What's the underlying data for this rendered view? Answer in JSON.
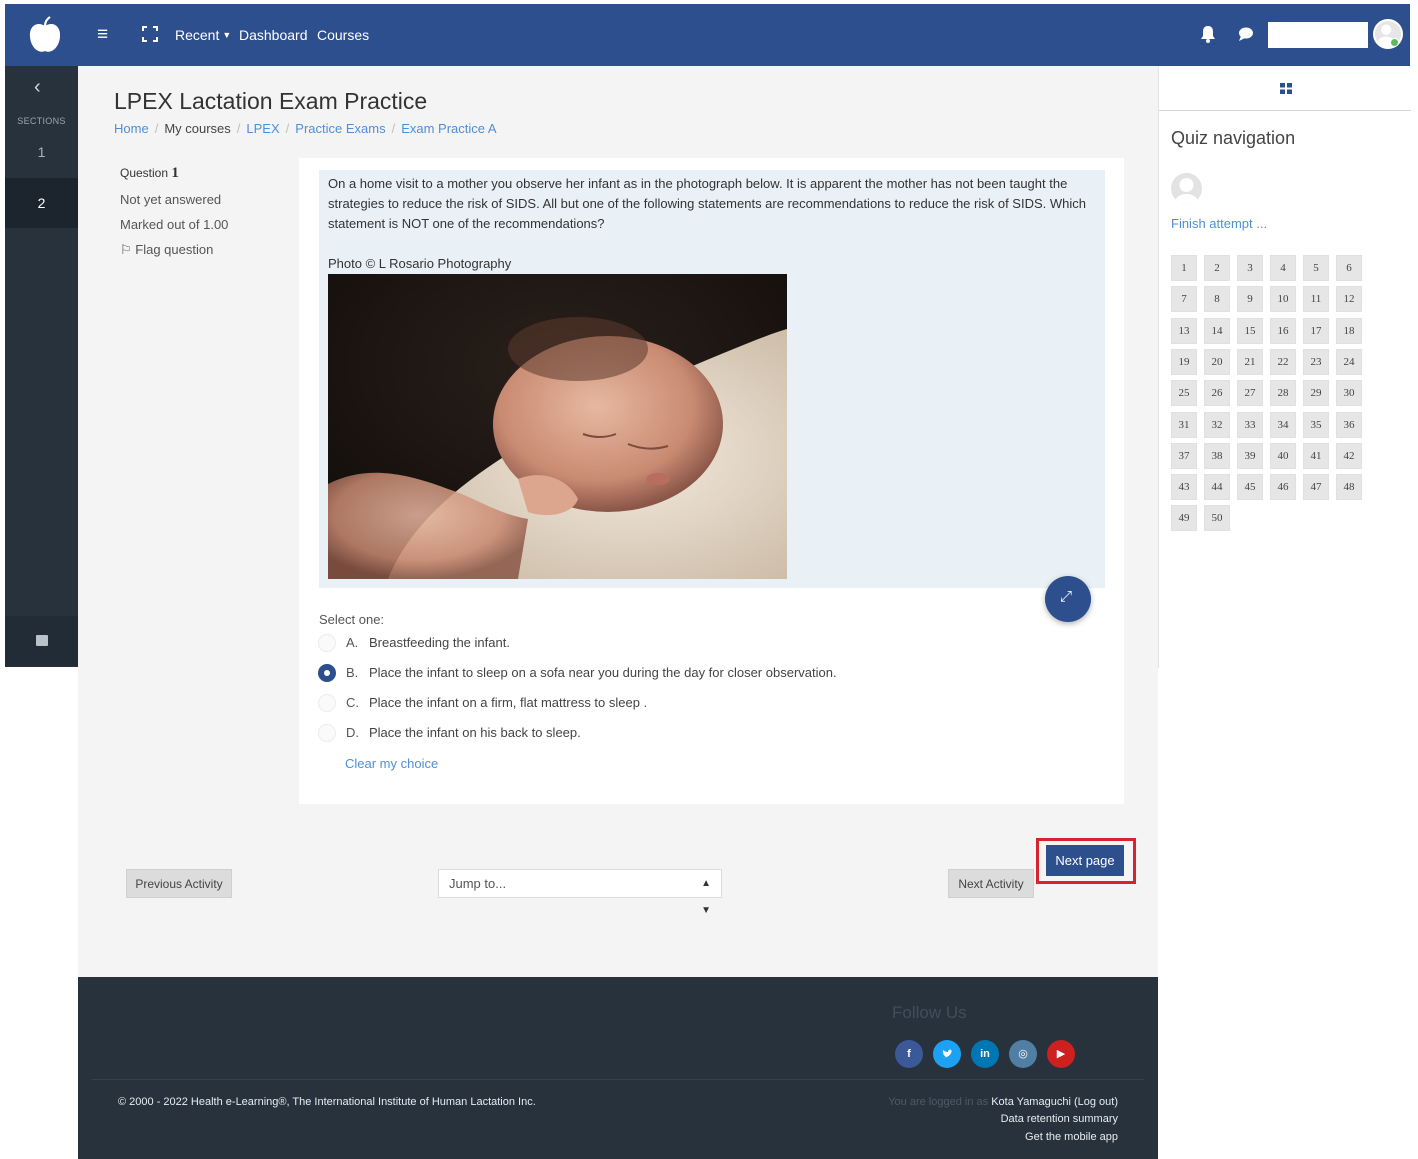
{
  "topbar": {
    "nav_links": [
      "Recent",
      "Dashboard",
      "Courses"
    ],
    "search_value": ""
  },
  "left_sidebar": {
    "sections_label": "SECTIONS",
    "items": [
      "1",
      "2"
    ]
  },
  "page": {
    "title": "LPEX Lactation Exam Practice",
    "breadcrumb": [
      "Home",
      "My courses",
      "LPEX",
      "Practice Exams",
      "Exam Practice A"
    ]
  },
  "question_info": {
    "question_label": "Question",
    "question_number": "1",
    "state": "Not yet answered",
    "marks": "Marked out of 1.00",
    "flag": "Flag question"
  },
  "question": {
    "text": "On a home visit to a mother you observe her infant as in the photograph below. It is apparent the mother has not been taught the strategies to reduce the risk of SIDS. All but one of the following statements are recommendations to reduce the risk of SIDS. Which statement is NOT one of the recommendations?",
    "photo_credit": "Photo © L Rosario Photography",
    "select_label": "Select one:",
    "options": [
      {
        "letter": "A.",
        "text": "Breastfeeding the infant.",
        "checked": false
      },
      {
        "letter": "B.",
        "text": "Place the infant to sleep on a sofa near you during the day for closer observation.",
        "checked": true
      },
      {
        "letter": "C.",
        "text": "Place the infant on a firm, flat mattress to sleep .",
        "checked": false
      },
      {
        "letter": "D.",
        "text": "Place the infant on his back to sleep.",
        "checked": false
      }
    ],
    "clear_choice": "Clear my choice"
  },
  "actions": {
    "next_page": "Next page",
    "previous_activity": "Previous Activity",
    "jump_to": "Jump to...",
    "next_activity": "Next Activity"
  },
  "quiz_navigation": {
    "title": "Quiz navigation",
    "finish_attempt": "Finish attempt ...",
    "questions": [
      "1",
      "2",
      "3",
      "4",
      "5",
      "6",
      "7",
      "8",
      "9",
      "10",
      "11",
      "12",
      "13",
      "14",
      "15",
      "16",
      "17",
      "18",
      "19",
      "20",
      "21",
      "22",
      "23",
      "24",
      "25",
      "26",
      "27",
      "28",
      "29",
      "30",
      "31",
      "32",
      "33",
      "34",
      "35",
      "36",
      "37",
      "38",
      "39",
      "40",
      "41",
      "42",
      "43",
      "44",
      "45",
      "46",
      "47",
      "48",
      "49",
      "50"
    ]
  },
  "footer": {
    "follow_us": "Follow Us",
    "social_icons": [
      "facebook-icon",
      "twitter-icon",
      "linkedin-icon",
      "instagram-icon",
      "youtube-icon"
    ],
    "social_colors": [
      "#3b5998",
      "#1da1f2",
      "#0077b5",
      "#517fa4",
      "#cd201f"
    ],
    "copyright": "© 2000 - 2022 Health e-Learning®, The International Institute of Human Lactation Inc.",
    "logged_in_prefix": "You are logged in as",
    "user_name": "Kota Yamaguchi",
    "logout": "Log out",
    "data_retention": "Data retention summary",
    "mobile_app": "Get the mobile app"
  },
  "colors": {
    "brand": "#2d4f8e",
    "link": "#4f8fd6",
    "sidebar": "#27323d",
    "highlight": "#d6242e"
  }
}
